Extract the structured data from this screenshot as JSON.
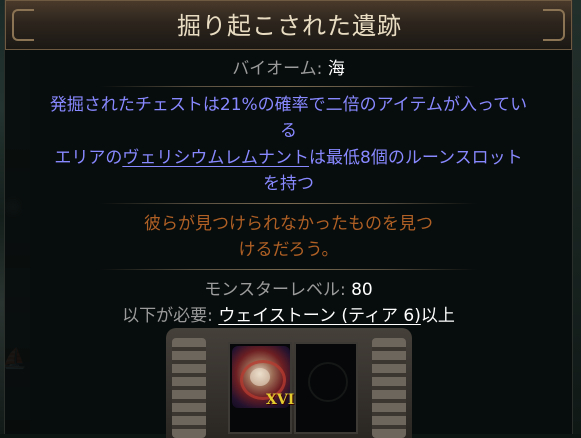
{
  "tooltip": {
    "title": "掘り起こされた遺跡",
    "biome_label": "バイオーム:",
    "biome_value": "海",
    "implicit_1_line1": "発掘されたチェストは21%の確率で二倍のアイテムが入ってい",
    "implicit_1_line2": "る",
    "implicit_2_prefix": "エリアの",
    "implicit_2_link": "ヴェリシウムレムナント",
    "implicit_2_suffix": "は最低8個のルーンスロット",
    "implicit_2_line2": "を持つ",
    "flavour_line1": "彼らが見つけられなかったものを見つ",
    "flavour_line2": "けるだろう。",
    "monster_level_label": "モンスターレベル:",
    "monster_level_value": "80",
    "requires_label": "以下が必要:",
    "requires_value": "ウェイストーン (ティア 6)",
    "requires_suffix": "以上"
  },
  "socket": {
    "item_tier": "XVI",
    "item_icon": "waystone-icon",
    "empty_slot_icon": "ornament-icon"
  },
  "colors": {
    "header_text": "#e8dcc2",
    "magic_blue": "#8888ff",
    "flavour_orange": "#af6025",
    "label_grey": "#9b9b9b",
    "value_white": "#ffffff",
    "tier_gold": "#e4cc2f"
  }
}
